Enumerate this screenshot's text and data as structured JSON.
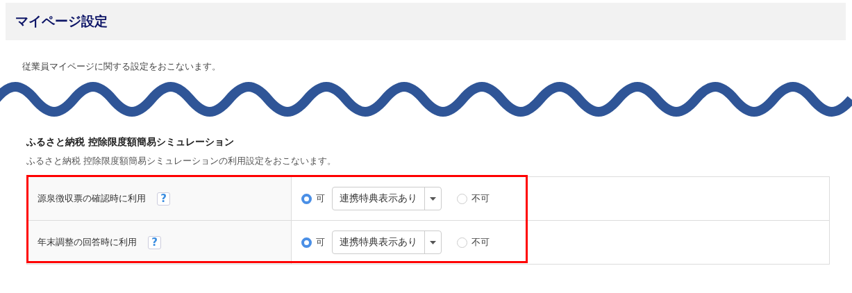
{
  "page": {
    "title": "マイページ設定",
    "description": "従業員マイページに関する設定をおこないます。"
  },
  "section": {
    "title": "ふるさと納税 控除限度額簡易シミュレーション",
    "description": "ふるさと納税 控除限度額簡易シミュレーションの利用設定をおこないます。"
  },
  "settings": [
    {
      "label": "源泉徴収票の確認時に利用",
      "help": "?",
      "options": [
        {
          "label": "可",
          "selected": true
        },
        {
          "label": "不可",
          "selected": false
        }
      ],
      "dropdown": {
        "value": "連携特典表示あり"
      }
    },
    {
      "label": "年末調整の回答時に利用",
      "help": "?",
      "options": [
        {
          "label": "可",
          "selected": true
        },
        {
          "label": "不可",
          "selected": false
        }
      ],
      "dropdown": {
        "value": "連携特典表示あり"
      }
    }
  ],
  "highlight": true
}
